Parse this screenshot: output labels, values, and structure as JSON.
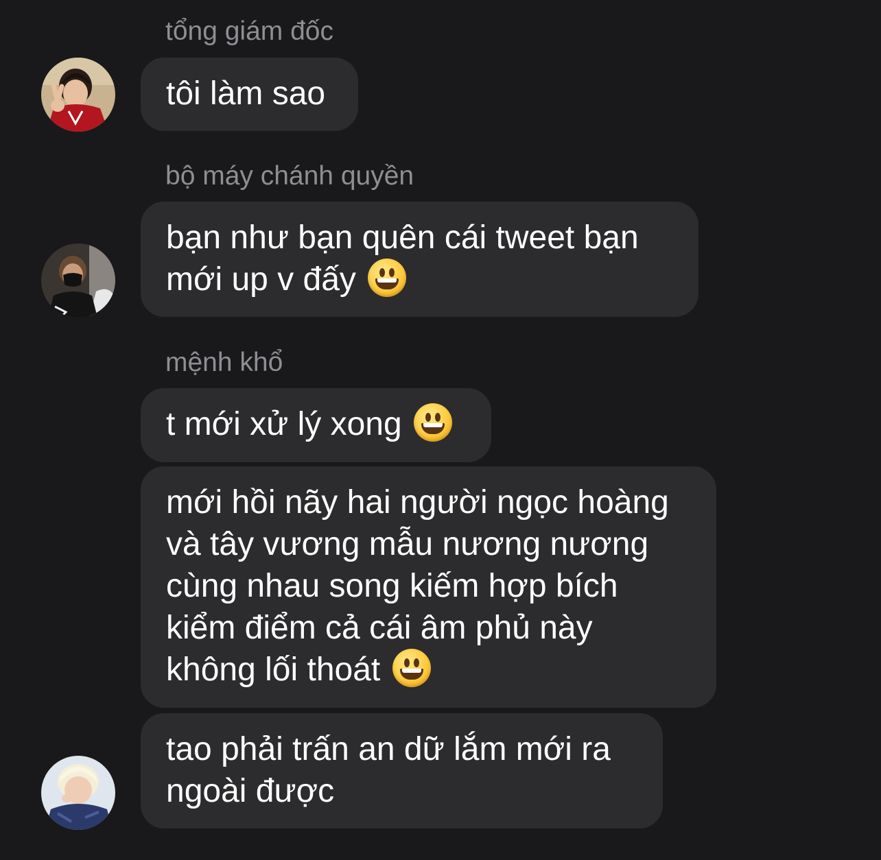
{
  "messages": [
    {
      "sender": "tổng giám đốc",
      "avatar_icon": "user-avatar-boy-red-shirt",
      "lines": [
        "tôi làm sao"
      ]
    },
    {
      "sender": "bộ máy chánh quyền",
      "avatar_icon": "user-avatar-masked-person",
      "lines": [
        "bạn như bạn quên cái tweet bạn",
        "mới up v đấy"
      ],
      "emoji": "grinning-face"
    },
    {
      "sender": "mệnh khổ",
      "avatar_icon": "user-avatar-blonde-person",
      "bubbles": [
        {
          "lines": [
            "t mới xử lý xong"
          ],
          "emoji": "grinning-face"
        },
        {
          "lines": [
            "mới hồi nãy hai người ngọc hoàng",
            "và tây vương mẫu nương nương",
            "cùng nhau song kiếm hợp bích",
            "kiểm điểm cả cái âm phủ này",
            "không lối thoát"
          ],
          "emoji": "grinning-face"
        },
        {
          "lines": [
            "tao phải trấn an dữ lắm mới ra",
            "ngoài được"
          ]
        }
      ]
    }
  ],
  "colors": {
    "background": "#19191b",
    "bubble": "#2c2c2e",
    "sender_name": "#8e8e93",
    "message_text": "#ffffff"
  }
}
